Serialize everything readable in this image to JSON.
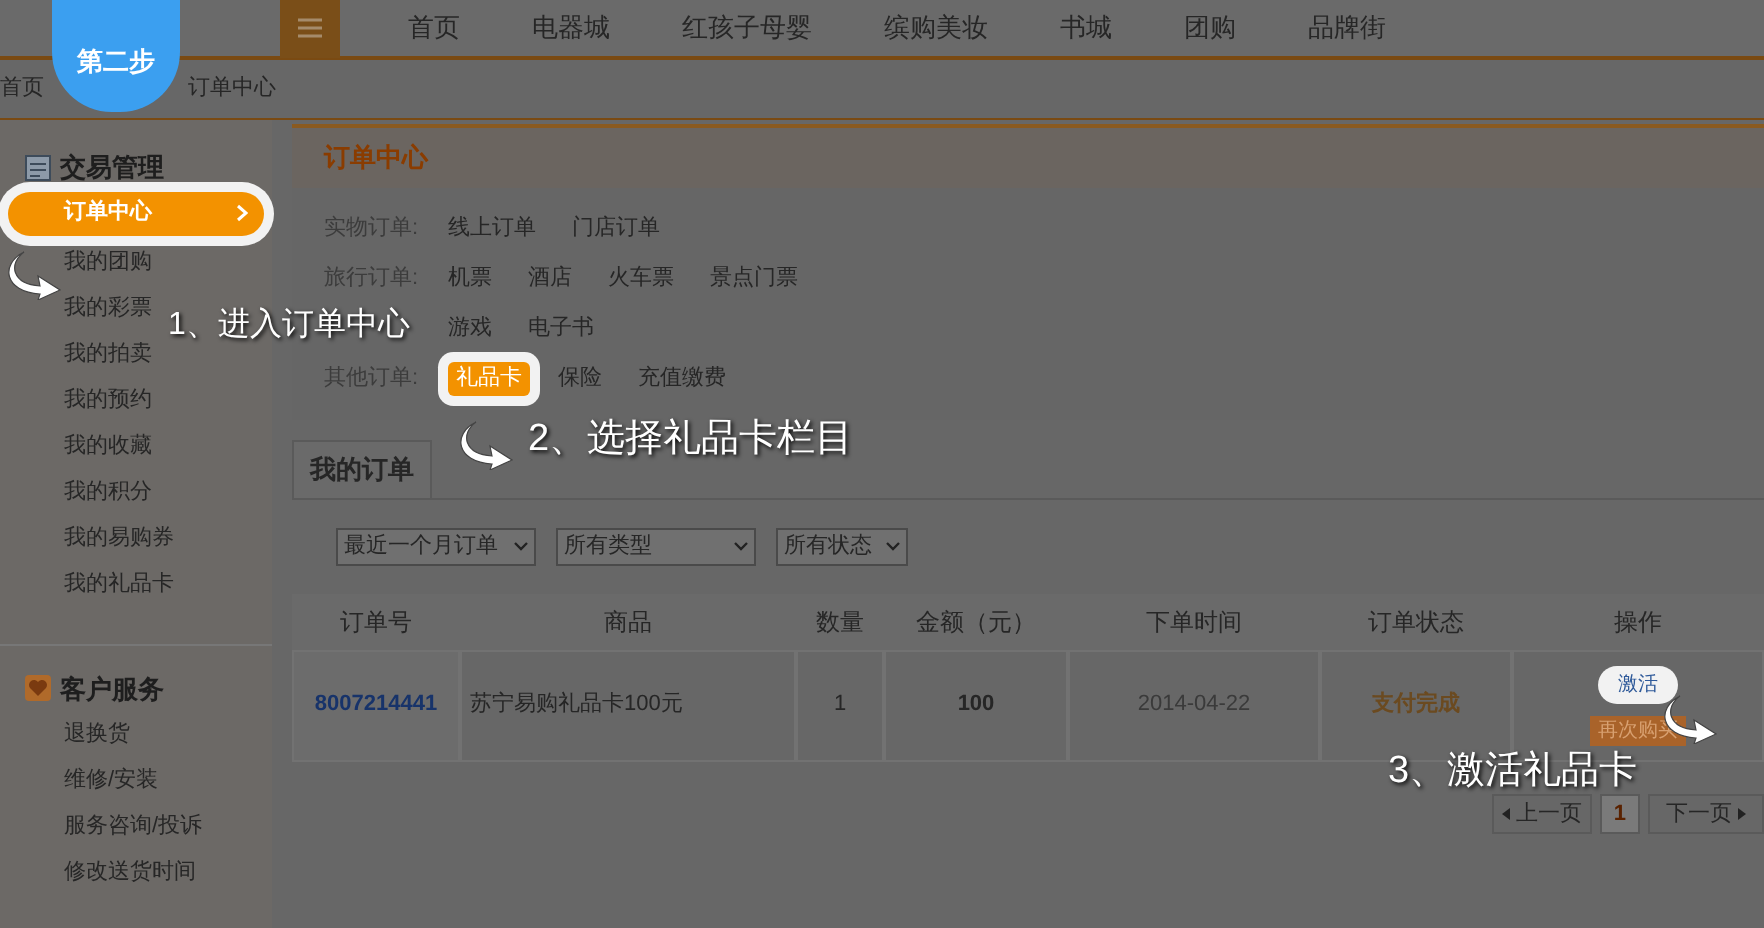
{
  "step_badge": "第二步",
  "nav": {
    "items": [
      "首页",
      "电器城",
      "红孩子母婴",
      "缤购美妆",
      "书城",
      "团购",
      "品牌街"
    ]
  },
  "breadcrumb": [
    "首页",
    "订单中心"
  ],
  "sidebar": {
    "sections": [
      {
        "kind": "trade",
        "title": "交易管理",
        "items": [
          {
            "label": "订单中心",
            "selected": true
          },
          {
            "label": "我的团购",
            "selected": false
          },
          {
            "label": "我的彩票",
            "selected": false
          },
          {
            "label": "我的拍卖",
            "selected": false
          },
          {
            "label": "我的预约",
            "selected": false
          },
          {
            "label": "我的收藏",
            "selected": false
          },
          {
            "label": "我的积分",
            "selected": false
          },
          {
            "label": "我的易购券",
            "selected": false
          },
          {
            "label": "我的礼品卡",
            "selected": false
          }
        ]
      },
      {
        "kind": "service",
        "title": "客户服务",
        "items": [
          {
            "label": "退换货",
            "selected": false
          },
          {
            "label": "维修/安装",
            "selected": false
          },
          {
            "label": "服务咨询/投诉",
            "selected": false
          },
          {
            "label": "修改送货时间",
            "selected": false
          }
        ]
      }
    ]
  },
  "order_center": {
    "title": "订单中心",
    "rows": [
      {
        "label": "实物订单:",
        "links": [
          {
            "label": "线上订单",
            "selected": false
          },
          {
            "label": "门店订单",
            "selected": false
          }
        ]
      },
      {
        "label": "旅行订单:",
        "links": [
          {
            "label": "机票",
            "selected": false
          },
          {
            "label": "酒店",
            "selected": false
          },
          {
            "label": "火车票",
            "selected": false
          },
          {
            "label": "景点门票",
            "selected": false
          }
        ]
      },
      {
        "links": [
          {
            "label": "游戏",
            "selected": false
          },
          {
            "label": "电子书",
            "selected": false
          }
        ]
      },
      {
        "label": "其他订单:",
        "links": [
          {
            "label": "礼品卡",
            "selected": true
          },
          {
            "label": "保险",
            "selected": false
          },
          {
            "label": "充值缴费",
            "selected": false
          }
        ]
      }
    ]
  },
  "tab": "我的订单",
  "filters": [
    "最近一个月订单",
    "所有类型",
    "所有状态"
  ],
  "table": {
    "columns": [
      "订单号",
      "商品",
      "数量",
      "金额（元）",
      "下单时间",
      "订单状态",
      "操作"
    ],
    "rows": [
      {
        "order_no": "8007214441",
        "product": "苏宁易购礼品卡100元",
        "qty": "1",
        "amount": "100",
        "date": "2014-04-22",
        "status": "支付完成",
        "actions": [
          {
            "label": "激活",
            "highlighted": true
          },
          {
            "label": "再次购买",
            "highlighted": false
          }
        ]
      }
    ]
  },
  "pagination": {
    "prev": "上一页",
    "pages": [
      {
        "label": "1",
        "selected": true
      }
    ],
    "next": "下一页"
  },
  "annotations": [
    "1、进入订单中心",
    "2、选择礼品卡栏目",
    "3、激活礼品卡"
  ]
}
